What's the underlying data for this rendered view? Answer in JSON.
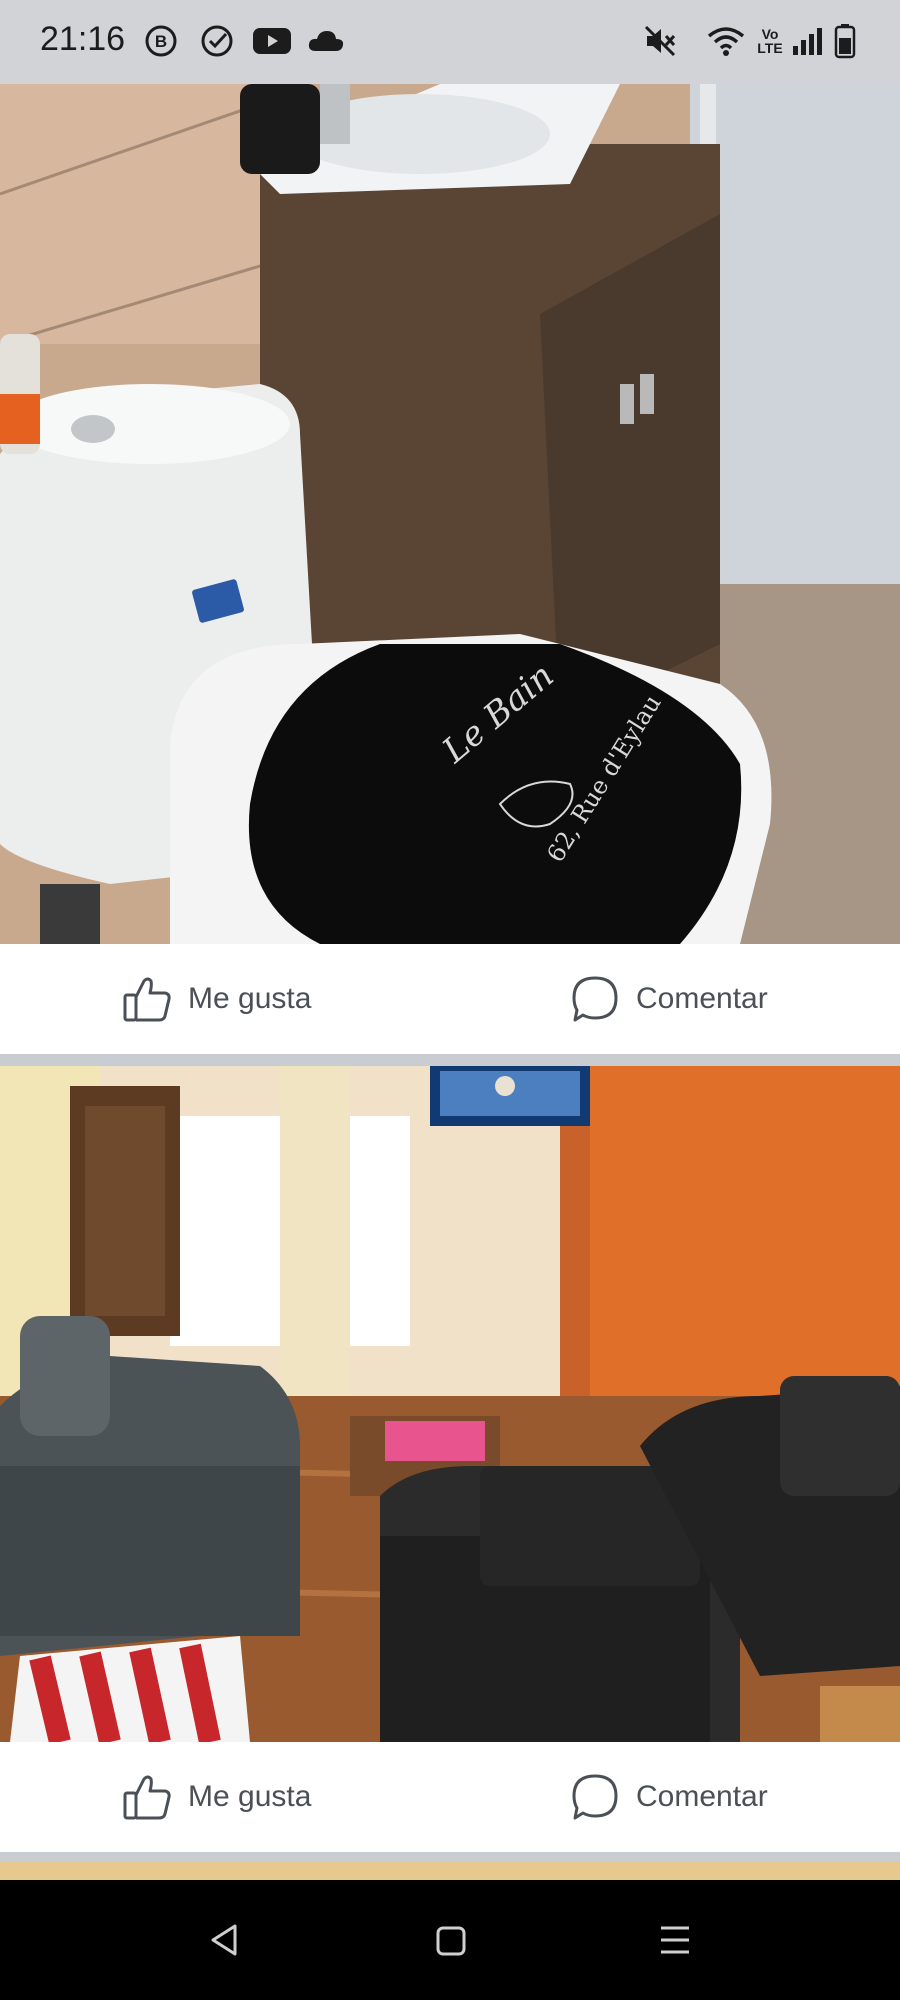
{
  "status_bar": {
    "time": "21:16",
    "network_label": "Vo LTE",
    "left_icons": [
      "b-circle-icon",
      "check-circle-icon",
      "youtube-icon",
      "cloud-icon"
    ],
    "right_icons": [
      "mute-icon",
      "wifi-icon",
      "volte-icon",
      "signal-icon",
      "battery-icon"
    ]
  },
  "feed": {
    "posts": [
      {
        "photo_subject": "bathroom",
        "seat_cover_text": [
          "Le Bain",
          "62, Rue d'Eylau"
        ],
        "like_label": "Me gusta",
        "comment_label": "Comentar"
      },
      {
        "photo_subject": "living-room",
        "like_label": "Me gusta",
        "comment_label": "Comentar"
      }
    ]
  },
  "nav_bar": {
    "buttons": [
      "back-icon",
      "home-icon",
      "menu-icon"
    ]
  },
  "colors": {
    "status_bar_bg": "#d1d3d7",
    "separator": "#c9ccd1",
    "action_text": "#4b4f56",
    "nav_bar_bg": "#000000"
  }
}
